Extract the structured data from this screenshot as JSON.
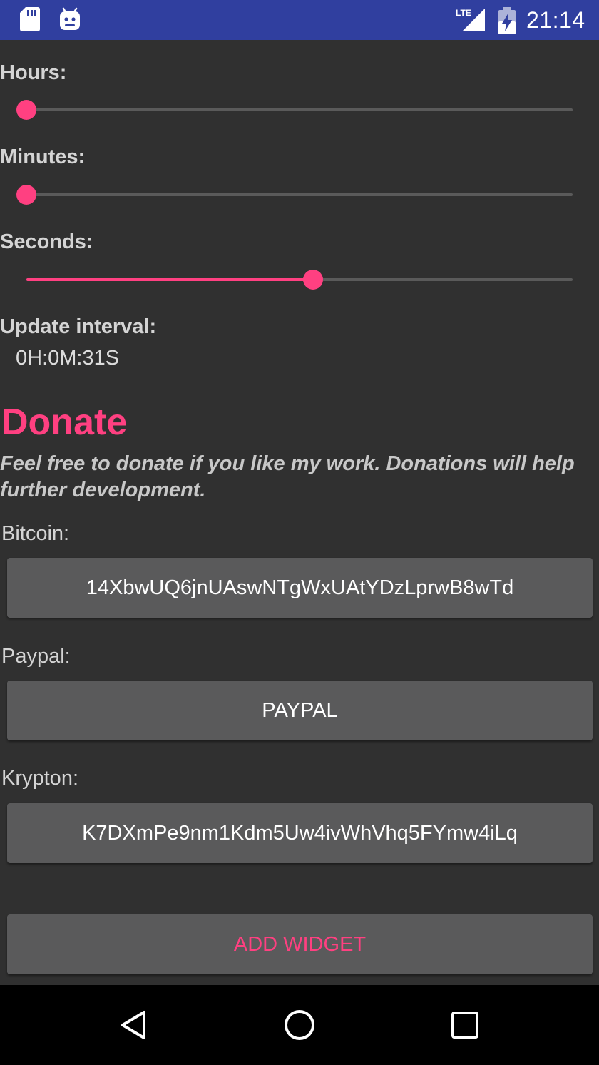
{
  "status_bar": {
    "time": "21:14",
    "network": "LTE",
    "icons": [
      "sd-card-icon",
      "android-icon",
      "lte-signal-icon",
      "battery-charging-icon"
    ]
  },
  "settings": {
    "hours_label": "Hours:",
    "minutes_label": "Minutes:",
    "seconds_label": "Seconds:",
    "hours_fraction": 0,
    "minutes_fraction": 0,
    "seconds_fraction": 0.525,
    "interval_label": "Update interval:",
    "interval_value": "0H:0M:31S"
  },
  "donate": {
    "title": "Donate",
    "description": "Feel free to donate if you like my work. Donations will help further development.",
    "bitcoin_label": "Bitcoin:",
    "bitcoin_address": "14XbwUQ6jnUAswNTgWxUAtYDzLprwB8wTd",
    "paypal_label": "Paypal:",
    "paypal_button": "PAYPAL",
    "krypton_label": "Krypton:",
    "krypton_address": "K7DXmPe9nm1Kdm5Uw4ivWhVhq5FYmw4iLq"
  },
  "actions": {
    "add_widget": "ADD WIDGET"
  },
  "colors": {
    "accent": "#ff4081",
    "status_bar": "#303f9f",
    "background": "#303030",
    "button": "#5a5a5b"
  },
  "nav_bar": {
    "icons": [
      "back-icon",
      "home-icon",
      "recents-icon"
    ]
  }
}
